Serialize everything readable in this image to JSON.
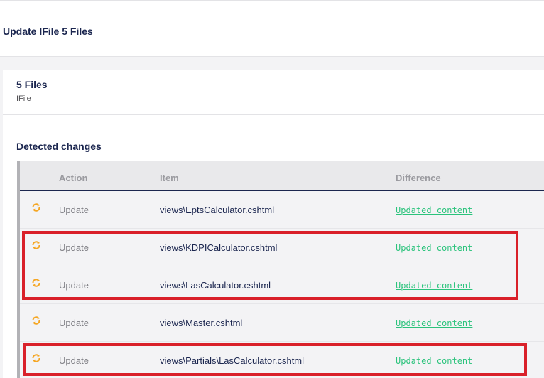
{
  "page": {
    "title": "Update IFile 5 Files"
  },
  "panel": {
    "title": "5 Files",
    "subtitle": "IFile",
    "section_label": "Detected changes"
  },
  "table": {
    "columns": [
      "Action",
      "Item",
      "Difference"
    ],
    "rows": [
      {
        "action": "Update",
        "item": "views\\EptsCalculator.cshtml",
        "difference": "Updated content"
      },
      {
        "action": "Update",
        "item": "views\\KDPICalculator.cshtml",
        "difference": "Updated content"
      },
      {
        "action": "Update",
        "item": "views\\LasCalculator.cshtml",
        "difference": "Updated content"
      },
      {
        "action": "Update",
        "item": "views\\Master.cshtml",
        "difference": "Updated content"
      },
      {
        "action": "Update",
        "item": "views\\Partials\\LasCalculator.cshtml",
        "difference": "Updated content"
      }
    ]
  },
  "icons": {
    "row_status": "sync-icon"
  },
  "colors": {
    "accent_orange": "#f5a623",
    "link_green": "#2bc37c",
    "highlight_red": "#d92029",
    "text_navy": "#1b264f"
  }
}
